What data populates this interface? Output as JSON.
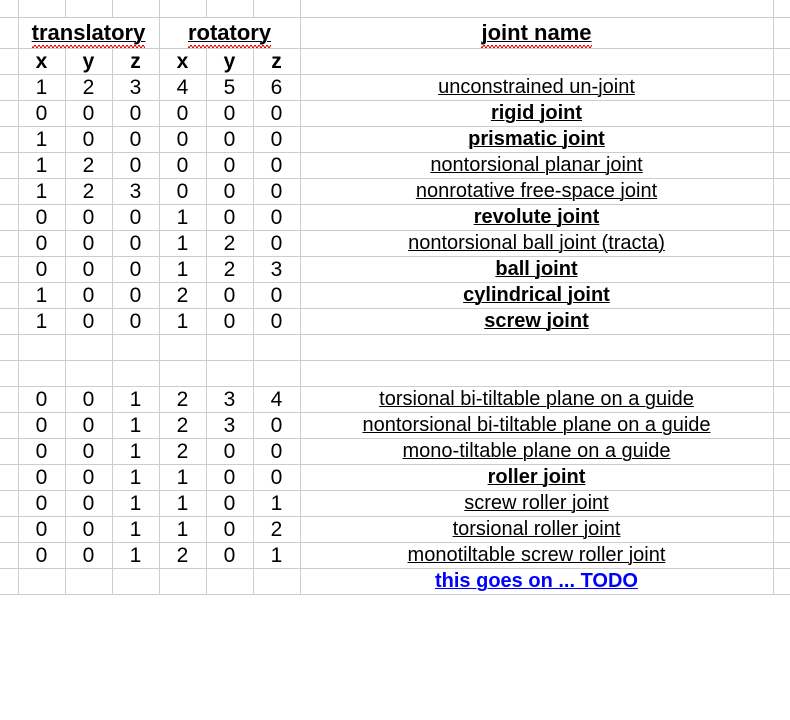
{
  "app": {
    "type": "spreadsheet",
    "gridline_color": "#cdcdcd",
    "spellcheck_underline_color": "#e60000",
    "accent_blue": "#0000ff"
  },
  "headers": {
    "group_translatory": "translatory",
    "group_rotatory": "rotatory",
    "name_column": "joint name",
    "axes": [
      "x",
      "y",
      "z",
      "x",
      "y",
      "z"
    ]
  },
  "rows": [
    {
      "nums": [
        "1",
        "2",
        "3",
        "4",
        "5",
        "6"
      ],
      "name": "unconstrained un-joint",
      "bold": false,
      "blue": false,
      "spell": true
    },
    {
      "nums": [
        "0",
        "0",
        "0",
        "0",
        "0",
        "0"
      ],
      "name": "rigid joint",
      "bold": true,
      "blue": false,
      "spell": true
    },
    {
      "nums": [
        "1",
        "0",
        "0",
        "0",
        "0",
        "0"
      ],
      "name": "prismatic joint",
      "bold": true,
      "blue": false,
      "spell": true
    },
    {
      "nums": [
        "1",
        "2",
        "0",
        "0",
        "0",
        "0"
      ],
      "name": "nontorsional planar joint",
      "bold": false,
      "blue": false,
      "spell": true
    },
    {
      "nums": [
        "1",
        "2",
        "3",
        "0",
        "0",
        "0"
      ],
      "name": "nonrotative free-space joint",
      "bold": false,
      "blue": false,
      "spell": true
    },
    {
      "nums": [
        "0",
        "0",
        "0",
        "1",
        "0",
        "0"
      ],
      "name": "revolute joint",
      "bold": true,
      "blue": false,
      "spell": true
    },
    {
      "nums": [
        "0",
        "0",
        "0",
        "1",
        "2",
        "0"
      ],
      "name": "nontorsional ball joint (tracta)",
      "bold": false,
      "blue": false,
      "spell": true
    },
    {
      "nums": [
        "0",
        "0",
        "0",
        "1",
        "2",
        "3"
      ],
      "name": "ball joint",
      "bold": true,
      "blue": false,
      "spell": true
    },
    {
      "nums": [
        "1",
        "0",
        "0",
        "2",
        "0",
        "0"
      ],
      "name": "cylindrical joint",
      "bold": true,
      "blue": false,
      "spell": true
    },
    {
      "nums": [
        "1",
        "0",
        "0",
        "1",
        "0",
        "0"
      ],
      "name": "screw joint",
      "bold": true,
      "blue": false,
      "spell": true
    },
    {
      "nums": [
        "",
        "",
        "",
        "",
        "",
        ""
      ],
      "name": "",
      "bold": false,
      "blue": false,
      "spell": false
    },
    {
      "nums": [
        "",
        "",
        "",
        "",
        "",
        ""
      ],
      "name": "",
      "bold": false,
      "blue": false,
      "spell": false
    },
    {
      "nums": [
        "0",
        "0",
        "1",
        "2",
        "3",
        "4"
      ],
      "name": "torsional bi-tiltable plane on a guide",
      "bold": false,
      "blue": false,
      "spell": true
    },
    {
      "nums": [
        "0",
        "0",
        "1",
        "2",
        "3",
        "0"
      ],
      "name": "nontorsional bi-tiltable plane on a guide",
      "bold": false,
      "blue": false,
      "spell": true
    },
    {
      "nums": [
        "0",
        "0",
        "1",
        "2",
        "0",
        "0"
      ],
      "name": "mono-tiltable plane on a guide",
      "bold": false,
      "blue": false,
      "spell": true
    },
    {
      "nums": [
        "0",
        "0",
        "1",
        "1",
        "0",
        "0"
      ],
      "name": "roller joint",
      "bold": true,
      "blue": false,
      "spell": true
    },
    {
      "nums": [
        "0",
        "0",
        "1",
        "1",
        "0",
        "1"
      ],
      "name": "screw roller joint",
      "bold": false,
      "blue": false,
      "spell": true
    },
    {
      "nums": [
        "0",
        "0",
        "1",
        "1",
        "0",
        "2"
      ],
      "name": "torsional roller joint",
      "bold": false,
      "blue": false,
      "spell": true
    },
    {
      "nums": [
        "0",
        "0",
        "1",
        "2",
        "0",
        "1"
      ],
      "name": "monotiltable screw roller joint",
      "bold": false,
      "blue": false,
      "spell": true
    },
    {
      "nums": [
        "",
        "",
        "",
        "",
        "",
        ""
      ],
      "name": "this goes on ... TODO",
      "bold": true,
      "blue": true,
      "spell": true
    }
  ]
}
